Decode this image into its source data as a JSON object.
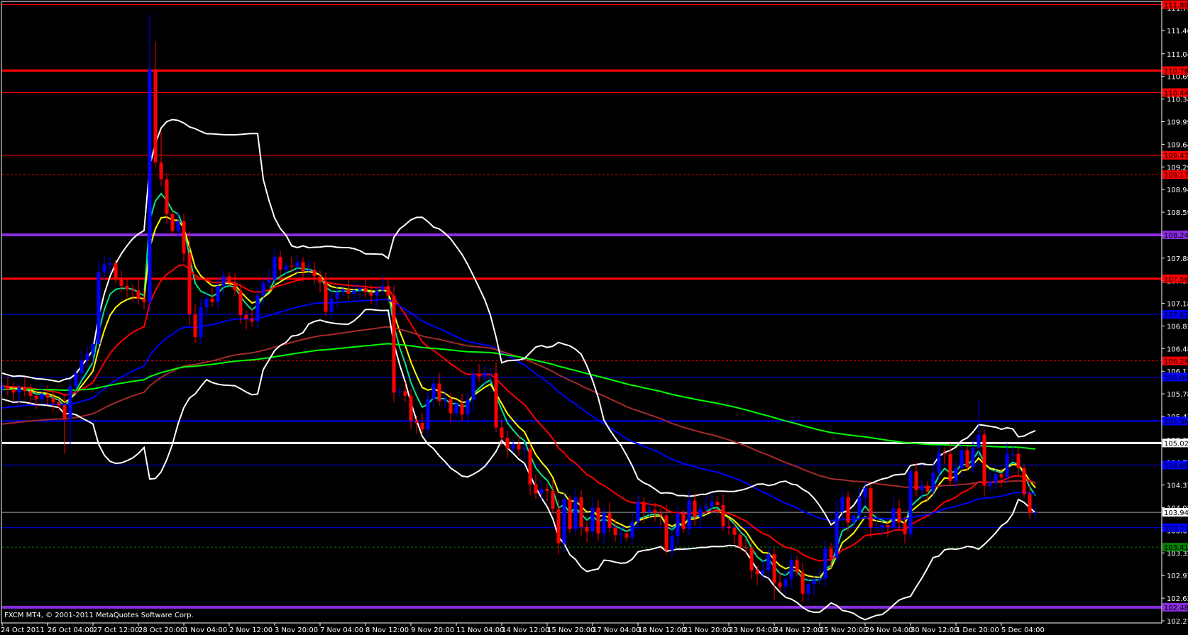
{
  "window": {
    "copyright": "FXCM MT4, © 2001-2011 MetaQuotes Software Corp."
  },
  "chart_data": {
    "type": "candlestick",
    "title": "",
    "timeframe_hours": 4,
    "bull_color": "#0000ff",
    "bear_color": "#ff0000",
    "ylim": [
      102.27,
      111.8
    ],
    "grid": false,
    "closes": [
      105.9,
      105.85,
      105.8,
      105.88,
      105.82,
      105.75,
      105.7,
      105.78,
      105.72,
      105.65,
      105.6,
      105.4,
      105.9,
      106.1,
      106.3,
      106.4,
      106.55,
      107.66,
      107.78,
      107.8,
      107.55,
      107.45,
      107.4,
      107.38,
      107.25,
      107.2,
      110.8,
      109.36,
      109.1,
      108.56,
      108.3,
      108.45,
      107.95,
      107.01,
      106.66,
      107.12,
      107.25,
      107.2,
      107.45,
      107.6,
      107.5,
      107.38,
      107.0,
      106.94,
      106.9,
      107.3,
      107.5,
      107.55,
      107.9,
      107.7,
      107.76,
      107.75,
      107.82,
      107.68,
      107.7,
      107.6,
      107.5,
      107.05,
      107.25,
      107.35,
      107.4,
      107.33,
      107.38,
      107.42,
      107.35,
      107.3,
      107.38,
      107.45,
      107.3,
      105.8,
      105.82,
      105.75,
      105.37,
      105.33,
      105.23,
      105.7,
      105.94,
      105.67,
      105.7,
      105.48,
      105.63,
      105.46,
      105.69,
      106.09,
      106.05,
      106.1,
      106.1,
      105.26,
      105.1,
      104.93,
      105.0,
      104.92,
      104.93,
      104.38,
      104.24,
      104.31,
      104.28,
      104.0,
      103.47,
      104.15,
      103.69,
      104.18,
      103.72,
      103.65,
      104.02,
      103.62,
      103.94,
      103.71,
      103.6,
      103.62,
      103.56,
      103.8,
      104.11,
      103.95,
      103.98,
      103.93,
      103.9,
      103.36,
      103.58,
      103.93,
      103.69,
      104.13,
      103.87,
      104.0,
      104.04,
      104.11,
      104.06,
      103.73,
      103.71,
      103.6,
      103.41,
      103.4,
      103.05,
      102.99,
      103.05,
      103.3,
      102.86,
      102.8,
      102.91,
      103.21,
      103.02,
      102.69,
      102.84,
      102.9,
      102.92,
      103.39,
      103.24,
      103.96,
      104.18,
      103.79,
      103.9,
      104.18,
      104.32,
      103.72,
      103.72,
      103.75,
      103.72,
      104.01,
      103.79,
      103.61,
      104.58,
      104.29,
      104.36,
      104.27,
      104.56,
      104.87,
      104.85,
      104.43,
      104.63,
      104.91,
      104.65,
      104.95,
      105.15,
      104.36,
      104.41,
      104.54,
      104.49,
      104.85,
      104.85,
      104.63,
      104.23,
      103.94,
      103.948
    ],
    "first_open": 105.85,
    "default_wick": 0.12,
    "high_overrides": {
      "26": 111.65,
      "27": 111.22,
      "28": 109.85,
      "33": 108.3,
      "172": 105.68,
      "69": 107.45
    },
    "low_overrides": {
      "11": 104.85,
      "12": 105.0,
      "98": 103.3,
      "141": 102.55,
      "136": 102.6
    },
    "indicators": [
      {
        "name": "EMA 5",
        "kind": "ema",
        "period": 5,
        "color": "#00e68a"
      },
      {
        "name": "EMA 8",
        "kind": "ema",
        "period": 8,
        "color": "#ffff00"
      },
      {
        "name": "EMA 21",
        "kind": "ema",
        "period": 21,
        "color": "#ff0000"
      },
      {
        "name": "EMA 55",
        "kind": "ema",
        "period": 55,
        "color": "#0000ff",
        "seed": 105.55
      },
      {
        "name": "EMA 100",
        "kind": "ema",
        "period": 100,
        "color": "#a52a2a",
        "seed": 105.3
      },
      {
        "name": "EMA 200",
        "kind": "ema",
        "period": 200,
        "color": "#00ff00",
        "seed": 105.85
      },
      {
        "name": "Bollinger Bands 20,2",
        "kind": "bb",
        "period": 20,
        "deviations": 2,
        "color": "#ffffff"
      }
    ],
    "price_levels": [
      {
        "price": 111.8,
        "label": "111.800",
        "color": "#ff0000",
        "style": "solid",
        "weight": 1,
        "text_color": "#000000"
      },
      {
        "price": 110.78,
        "label": "110.780",
        "color": "#ff0000",
        "style": "solid",
        "weight": 3,
        "text_color": "#000000"
      },
      {
        "price": 110.44,
        "label": "110.440",
        "color": "#ff0000",
        "style": "solid",
        "weight": 1,
        "text_color": "#000000"
      },
      {
        "price": 109.47,
        "label": "109.470",
        "color": "#ff0000",
        "style": "solid",
        "weight": 1,
        "text_color": "#000000"
      },
      {
        "price": 109.17,
        "label": "109.170",
        "color": "#ff0000",
        "style": "dashed",
        "weight": 1,
        "text_color": "#000000"
      },
      {
        "price": 108.24,
        "label": "108.240",
        "color": "#8a2be2",
        "style": "solid",
        "weight": 4,
        "text_color": "#000000"
      },
      {
        "price": 107.56,
        "label": "107.560",
        "color": "#ff0000",
        "style": "solid",
        "weight": 3,
        "text_color": "#000000"
      },
      {
        "price": 107.01,
        "label": "107.010",
        "color": "#0000ff",
        "style": "solid",
        "weight": 1,
        "text_color": "#000000"
      },
      {
        "price": 106.29,
        "label": "106.290",
        "color": "#ff0000",
        "style": "dashed",
        "weight": 1,
        "text_color": "#000000"
      },
      {
        "price": 106.04,
        "label": "106.040",
        "color": "#0000ff",
        "style": "solid",
        "weight": 1,
        "text_color": "#000000"
      },
      {
        "price": 105.36,
        "label": "105.360",
        "color": "#0000ff",
        "style": "solid",
        "weight": 2,
        "text_color": "#000000"
      },
      {
        "price": 105.02,
        "label": "105.020",
        "color": "#ffffff",
        "style": "solid",
        "weight": 3,
        "text_color": "#000000"
      },
      {
        "price": 104.68,
        "label": "104.680",
        "color": "#0000ff",
        "style": "solid",
        "weight": 1,
        "text_color": "#000000"
      },
      {
        "price": 103.948,
        "label": "103.948",
        "color": "#a0a0a0",
        "style": "solid",
        "weight": 1,
        "text_color": "#000000",
        "box_color": "#ffffff"
      },
      {
        "price": 103.71,
        "label": "103.710",
        "color": "#0000ff",
        "style": "solid",
        "weight": 1,
        "text_color": "#000000"
      },
      {
        "price": 103.41,
        "label": "103.410",
        "color": "#008000",
        "style": "dashed",
        "weight": 1,
        "text_color": "#000000"
      },
      {
        "price": 102.48,
        "label": "102.480",
        "color": "#8a2be2",
        "style": "solid",
        "weight": 4,
        "text_color": "#000000"
      }
    ],
    "y_ticks": [
      "111.750",
      "111.400",
      "111.040",
      "110.690",
      "110.340",
      "109.990",
      "109.640",
      "109.290",
      "108.940",
      "108.590",
      "108.230",
      "107.880",
      "107.530",
      "107.180",
      "106.830",
      "106.480",
      "106.130",
      "105.780",
      "105.430",
      "105.070",
      "104.720",
      "104.370",
      "104.020",
      "103.670",
      "103.320",
      "102.970",
      "102.620",
      "102.270"
    ],
    "x_ticks": [
      "24 Oct 2011",
      "26 Oct 04:00",
      "27 Oct 12:00",
      "28 Oct 20:00",
      "1 Nov 04:00",
      "2 Nov 12:00",
      "3 Nov 20:00",
      "7 Nov 04:00",
      "8 Nov 12:00",
      "9 Nov 20:00",
      "11 Nov 04:00",
      "14 Nov 12:00",
      "15 Nov 20:00",
      "17 Nov 04:00",
      "18 Nov 12:00",
      "21 Nov 20:00",
      "23 Nov 04:00",
      "24 Nov 12:00",
      "25 Nov 20:00",
      "29 Nov 04:00",
      "30 Nov 12:00",
      "1 Dec 20:00",
      "5 Dec 04:00"
    ],
    "bars_per_x_tick": 8
  }
}
